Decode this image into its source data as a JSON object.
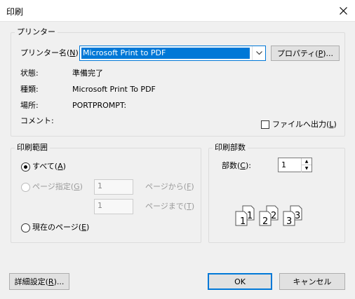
{
  "window": {
    "title": "印刷"
  },
  "printer": {
    "group_label": "プリンター",
    "name_label_pre": "プリンター名(",
    "name_label_key": "N",
    "name_label_post": "):",
    "selected_printer": "Microsoft Print to PDF",
    "properties_pre": "プロパティ(",
    "properties_key": "P",
    "properties_post": ")...",
    "status_label": "状態:",
    "status_value": "準備完了",
    "type_label": "種類:",
    "type_value": "Microsoft Print To PDF",
    "location_label": "場所:",
    "location_value": "PORTPROMPT:",
    "comment_label": "コメント:",
    "print_to_file_pre": "ファイルへ出力(",
    "print_to_file_key": "L",
    "print_to_file_post": ")"
  },
  "range": {
    "group_label": "印刷範囲",
    "all_pre": "すべて(",
    "all_key": "A",
    "all_post": ")",
    "pages_pre": "ページ指定(",
    "pages_key": "G",
    "pages_post": ")",
    "from_value": "1",
    "from_pre": "ページから(",
    "from_key": "F",
    "from_post": ")",
    "to_value": "1",
    "to_pre": "ページまで(",
    "to_key": "T",
    "to_post": ")",
    "current_pre": "現在のページ(",
    "current_key": "E",
    "current_post": ")"
  },
  "copies": {
    "group_label": "印刷部数",
    "count_pre": "部数(",
    "count_key": "C",
    "count_post": "):",
    "count_value": "1",
    "collate_nums": [
      "1",
      "1",
      "2",
      "2",
      "3",
      "3"
    ]
  },
  "footer": {
    "advanced_pre": "詳細設定(",
    "advanced_key": "R",
    "advanced_post": ")...",
    "ok_label": "OK",
    "cancel_label": "キャンセル"
  },
  "colors": {
    "accent": "#0078d7",
    "background": "#f0f0f0"
  }
}
